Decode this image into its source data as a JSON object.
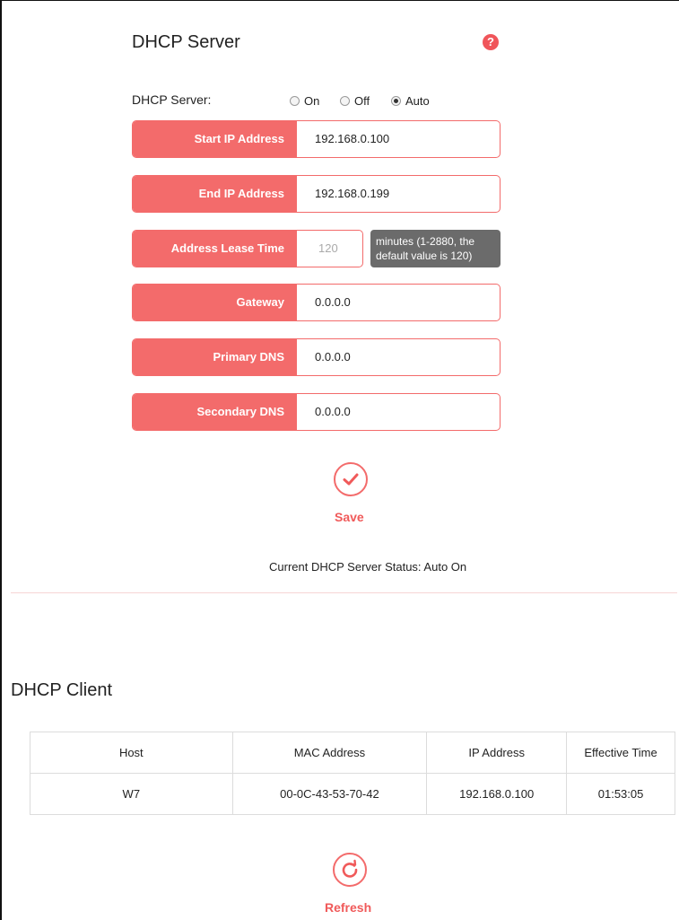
{
  "server": {
    "title": "DHCP Server",
    "help_icon": "?",
    "dhcp_label": "DHCP Server:",
    "options": [
      {
        "label": "On",
        "checked": false
      },
      {
        "label": "Off",
        "checked": false
      },
      {
        "label": "Auto",
        "checked": true
      }
    ],
    "fields": {
      "start_ip": {
        "label": "Start IP Address",
        "value": "192.168.0.100"
      },
      "end_ip": {
        "label": "End IP Address",
        "value": "192.168.0.199"
      },
      "lease": {
        "label": "Address Lease Time",
        "value": "120",
        "hint": "minutes (1-2880, the default value is 120)"
      },
      "gateway": {
        "label": "Gateway",
        "value": "0.0.0.0"
      },
      "primary_dns": {
        "label": "Primary DNS",
        "value": "0.0.0.0"
      },
      "secondary_dns": {
        "label": "Secondary DNS",
        "value": "0.0.0.0"
      }
    },
    "save_label": "Save",
    "status": "Current DHCP Server Status: Auto On"
  },
  "client": {
    "title": "DHCP Client",
    "columns": [
      "Host",
      "MAC Address",
      "IP Address",
      "Effective Time"
    ],
    "rows": [
      [
        "W7",
        "00-0C-43-53-70-42",
        "192.168.0.100",
        "01:53:05"
      ]
    ],
    "refresh_label": "Refresh"
  },
  "colors": {
    "accent": "#f36b6b",
    "hint_bg": "#6b6b6b"
  },
  "icons": {
    "save": "checkmark-icon",
    "refresh": "refresh-icon",
    "help": "question-icon"
  }
}
